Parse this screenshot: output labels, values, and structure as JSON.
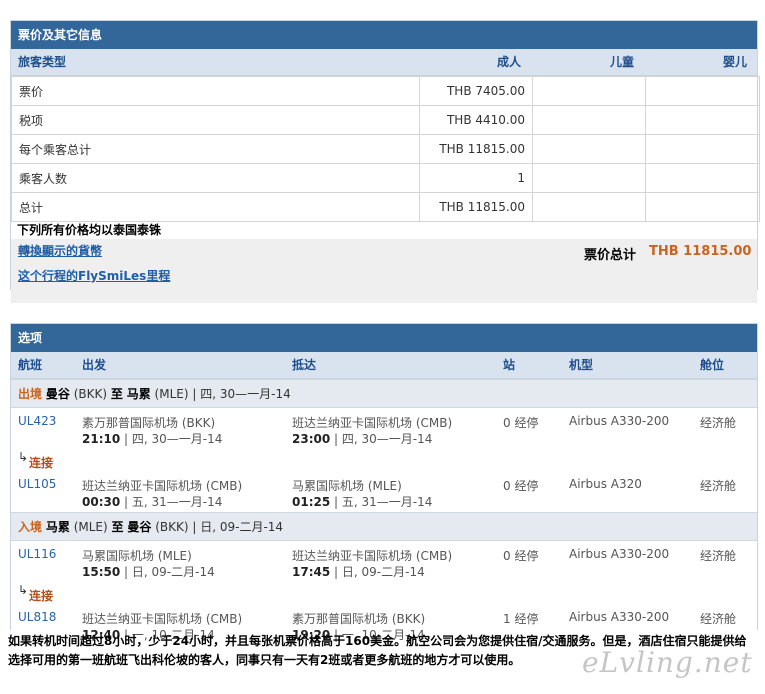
{
  "fare_panel": {
    "title": "票价及其它信息",
    "headers": {
      "type": "旅客类型",
      "adult": "成人",
      "child": "儿童",
      "infant": "婴儿"
    },
    "rows": [
      {
        "label": "票价",
        "adult": "THB 7405.00"
      },
      {
        "label": "税项",
        "adult": "THB 4410.00"
      },
      {
        "label": "每个乘客总计",
        "adult": "THB 11815.00"
      },
      {
        "label": "乘客人数",
        "adult": "1"
      },
      {
        "label": "总计",
        "adult": "THB 11815.00"
      }
    ],
    "currency_note": "下列所有价格均以泰国泰铢",
    "link_currency": "轉換顯示的貨幣",
    "link_flysmiles": "这个行程的FlySmiLes里程",
    "total_label": "票价总计",
    "total_value": "THB 11815.00"
  },
  "options_panel": {
    "title": "选项",
    "headers": {
      "flight": "航班",
      "depart": "出发",
      "arrive": "抵达",
      "stops": "站",
      "aircraft": "机型",
      "cabin": "舱位"
    },
    "segments": [
      {
        "direction": "出境",
        "from": "曼谷",
        "from_code": "(BKK)",
        "to_word": "至",
        "to": "马累",
        "to_code": "(MLE)",
        "date": "| 四, 30—一月-14",
        "flights": [
          {
            "no": "UL423",
            "dep_airport": "素万那普国际机场 (BKK)",
            "dep_time": "21:10",
            "dep_date": "| 四, 30—一月-14",
            "arr_airport": "班达兰纳亚卡国际机场 (CMB)",
            "arr_time": "23:00",
            "arr_date": "| 四, 30—一月-14",
            "stops": "0 经停",
            "aircraft": "Airbus A330-200",
            "cabin": "经济舱"
          },
          {
            "no": "UL105",
            "dep_airport": "班达兰纳亚卡国际机场 (CMB)",
            "dep_time": "00:30",
            "dep_date": "| 五, 31—一月-14",
            "arr_airport": "马累国际机场 (MLE)",
            "arr_time": "01:25",
            "arr_date": "| 五, 31—一月-14",
            "stops": "0 经停",
            "aircraft": "Airbus A320",
            "cabin": "经济舱"
          }
        ]
      },
      {
        "direction": "入境",
        "from": "马累",
        "from_code": "(MLE)",
        "to_word": "至",
        "to": "曼谷",
        "to_code": "(BKK)",
        "date": "| 日, 09-二月-14",
        "flights": [
          {
            "no": "UL116",
            "dep_airport": "马累国际机场 (MLE)",
            "dep_time": "15:50",
            "dep_date": "| 日, 09-二月-14",
            "arr_airport": "班达兰纳亚卡国际机场 (CMB)",
            "arr_time": "17:45",
            "arr_date": "| 日, 09-二月-14",
            "stops": "0 经停",
            "aircraft": "Airbus A330-200",
            "cabin": "经济舱"
          },
          {
            "no": "UL818",
            "dep_airport": "班达兰纳亚卡国际机场 (CMB)",
            "dep_time": "12:40",
            "dep_date": "| 一, 10-二月-14",
            "arr_airport": "素万那普国际机场 (BKK)",
            "arr_time": "19:20",
            "arr_date": "| 一, 10-二月-14",
            "stops": "1 经停",
            "aircraft": "Airbus A330-200",
            "cabin": "经济舱"
          }
        ]
      }
    ],
    "connection_label": "连接"
  },
  "bottom_note": "如果转机时间超过8小时，少于24小时，并且每张机票价格高于160美金。航空公司会为您提供住宿/交通服务。但是，酒店住宿只能提供给选择可用的第一班航班飞出科伦坡的客人，同事只有一天有2班或者更多航班的地方才可以使用。",
  "watermark": "eLvling.net"
}
